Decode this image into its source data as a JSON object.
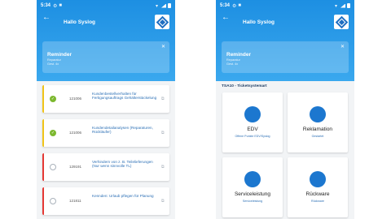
{
  "left": {
    "status": {
      "time": "5:34"
    },
    "greeting": "Hallo Syslog",
    "reminder": {
      "title": "Reminder",
      "line1": "Reparatur",
      "line2": "Gest. 4x"
    },
    "tasks": [
      {
        "id": "121006",
        "text": "Kundenbestellverhalten für Fertigungsauftrags Gehälterstückelung",
        "done": true,
        "color": "#f0c419"
      },
      {
        "id": "121006",
        "text": "Kundendetailanalysen (Reparaturen, Rückläufer)",
        "done": true,
        "color": "#f0c419"
      },
      {
        "id": "129191",
        "text": "Verhindern von z. B. Teilelieferungen (Nur wenn sinnvolle TL)",
        "done": false,
        "color": "#e53935"
      },
      {
        "id": "121811",
        "text": "Kennden: Urlaub pflegen für Planung",
        "done": false,
        "color": "#e53935"
      }
    ]
  },
  "right": {
    "status": {
      "time": "5:34"
    },
    "greeting": "Hallo Syslog",
    "reminder": {
      "title": "Reminder",
      "line1": "Reparatur",
      "line2": "Gest. 4x"
    },
    "section_title": "TSA10 - Ticketsystemart",
    "tiles": [
      {
        "label": "EDV",
        "sub": "Offene Punkte EDV/Syslog"
      },
      {
        "label": "Reklamation",
        "sub": "Gestartet"
      },
      {
        "label": "Serviceleistung",
        "sub": "Serviceleistung"
      },
      {
        "label": "Rückware",
        "sub": "Rückware"
      }
    ]
  },
  "colors": {
    "header": "#1d8fe2",
    "accent": "#1c77cf",
    "done": "#7cb82f"
  },
  "icons": {
    "back": "arrow-left-icon",
    "close": "close-icon",
    "copy": "copy-icon",
    "check": "check-icon"
  }
}
